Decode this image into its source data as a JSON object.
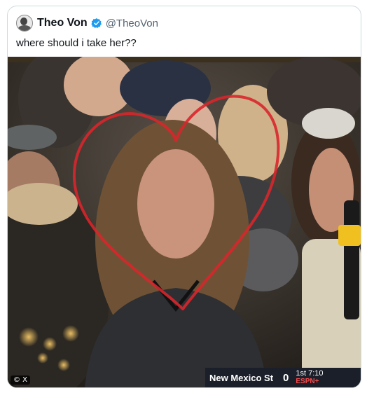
{
  "tweet": {
    "display_name": "Theo Von",
    "handle": "@TheoVon",
    "verified": true,
    "text": "where should i take her??",
    "avatar_icon": "user-avatar-icon"
  },
  "media": {
    "watermark": "© X",
    "ticker": {
      "team": "New Mexico St",
      "score": "0",
      "status": "1st 7:10",
      "network": "ESPN+"
    },
    "annotation": "red-heart-drawing",
    "colors": {
      "heart": "#d8262b",
      "verified": "#1d9bf0"
    }
  }
}
